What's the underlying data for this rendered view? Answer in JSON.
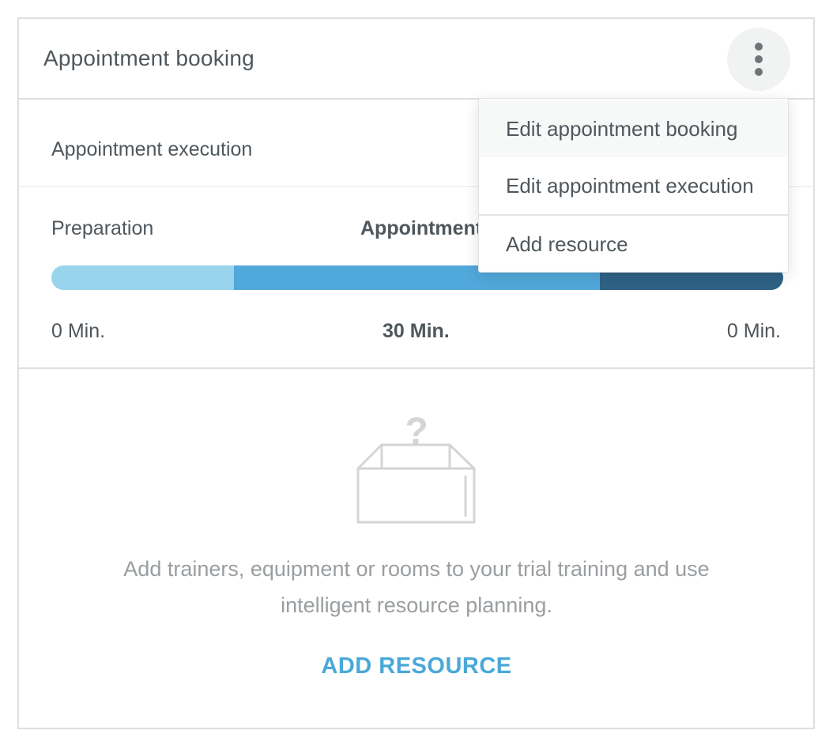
{
  "card": {
    "title": "Appointment booking"
  },
  "execution": {
    "title": "Appointment execution"
  },
  "timeline": {
    "phases": {
      "preparation": "Preparation",
      "appointment": "Appointment"
    },
    "durations": {
      "preparation": "0 Min.",
      "appointment": "30 Min.",
      "follow_up": "0 Min."
    },
    "colors": {
      "preparation": "#98d4ec",
      "appointment": "#51a8da",
      "follow_up": "#2f6285"
    }
  },
  "menu": {
    "items": [
      {
        "label": "Edit appointment booking"
      },
      {
        "label": "Edit appointment execution"
      },
      {
        "label": "Add resource"
      }
    ]
  },
  "empty_state": {
    "icon": "empty-box-question-icon",
    "message_line1": "Add trainers, equipment or rooms to your trial training and use",
    "message_line2": "intelligent resource planning.",
    "action_label": "ADD RESOURCE"
  },
  "icons": {
    "more": "more-vertical-icon"
  }
}
